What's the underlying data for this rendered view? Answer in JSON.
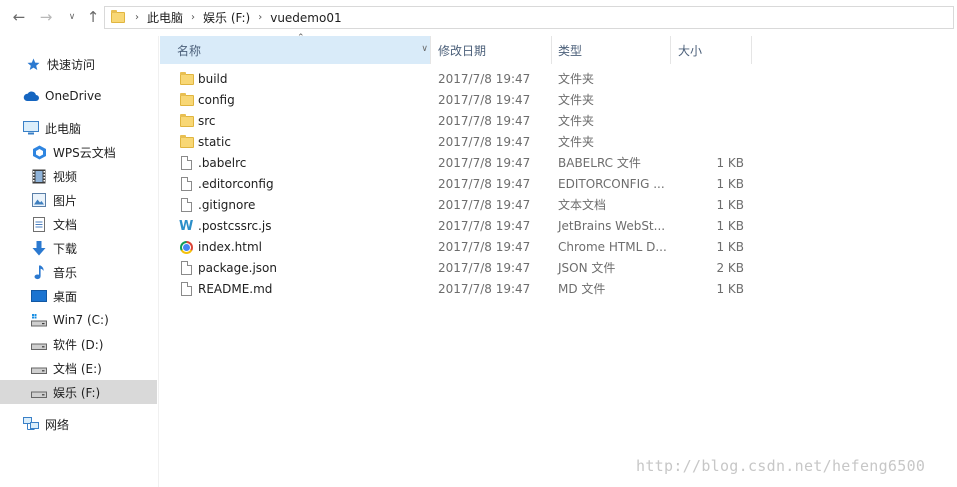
{
  "address": {
    "crumbs": [
      "此电脑",
      "娱乐 (F:)",
      "vuedemo01"
    ]
  },
  "sidebar": {
    "items": [
      {
        "label": "快速访问",
        "icon": "pin-icon"
      },
      {
        "label": "OneDrive",
        "icon": "cloud-icon"
      },
      {
        "label": "此电脑",
        "icon": "computer-icon"
      },
      {
        "label": "WPS云文档",
        "icon": "wps-cloud-icon"
      },
      {
        "label": "视频",
        "icon": "video-icon"
      },
      {
        "label": "图片",
        "icon": "picture-icon"
      },
      {
        "label": "文档",
        "icon": "document-icon"
      },
      {
        "label": "下载",
        "icon": "download-icon"
      },
      {
        "label": "音乐",
        "icon": "music-icon"
      },
      {
        "label": "桌面",
        "icon": "desktop-icon"
      },
      {
        "label": "Win7 (C:)",
        "icon": "system-drive-icon"
      },
      {
        "label": "软件 (D:)",
        "icon": "drive-icon"
      },
      {
        "label": "文档 (E:)",
        "icon": "drive-icon"
      },
      {
        "label": "娱乐 (F:)",
        "icon": "drive-icon",
        "selected": true
      },
      {
        "label": "网络",
        "icon": "network-icon"
      }
    ]
  },
  "columns": {
    "name": "名称",
    "date": "修改日期",
    "type": "类型",
    "size": "大小"
  },
  "files": [
    {
      "name": "build",
      "date": "2017/7/8 19:47",
      "type": "文件夹",
      "size": "",
      "icon": "folder-icon"
    },
    {
      "name": "config",
      "date": "2017/7/8 19:47",
      "type": "文件夹",
      "size": "",
      "icon": "folder-icon"
    },
    {
      "name": "src",
      "date": "2017/7/8 19:47",
      "type": "文件夹",
      "size": "",
      "icon": "folder-icon"
    },
    {
      "name": "static",
      "date": "2017/7/8 19:47",
      "type": "文件夹",
      "size": "",
      "icon": "folder-icon"
    },
    {
      "name": ".babelrc",
      "date": "2017/7/8 19:47",
      "type": "BABELRC 文件",
      "size": "1 KB",
      "icon": "file-icon"
    },
    {
      "name": ".editorconfig",
      "date": "2017/7/8 19:47",
      "type": "EDITORCONFIG ...",
      "size": "1 KB",
      "icon": "file-icon"
    },
    {
      "name": ".gitignore",
      "date": "2017/7/8 19:47",
      "type": "文本文档",
      "size": "1 KB",
      "icon": "text-file-icon"
    },
    {
      "name": ".postcssrc.js",
      "date": "2017/7/8 19:47",
      "type": "JetBrains WebSt...",
      "size": "1 KB",
      "icon": "webstorm-icon"
    },
    {
      "name": "index.html",
      "date": "2017/7/8 19:47",
      "type": "Chrome HTML D...",
      "size": "1 KB",
      "icon": "chrome-icon"
    },
    {
      "name": "package.json",
      "date": "2017/7/8 19:47",
      "type": "JSON 文件",
      "size": "2 KB",
      "icon": "file-icon"
    },
    {
      "name": "README.md",
      "date": "2017/7/8 19:47",
      "type": "MD 文件",
      "size": "1 KB",
      "icon": "file-icon"
    }
  ],
  "watermark": "http://blog.csdn.net/hefeng6500"
}
